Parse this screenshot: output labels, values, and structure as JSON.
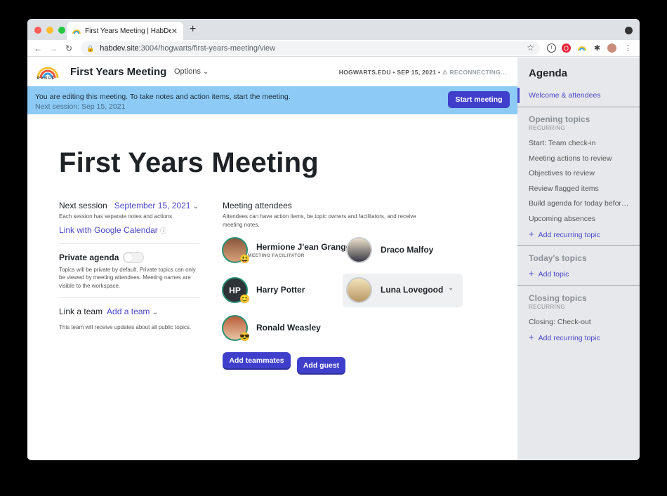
{
  "browser": {
    "tab_title": "First Years Meeting | HabDev",
    "url_host": "habdev.site",
    "url_path": ":3004/hogwarts/first-years-meeting/view"
  },
  "header": {
    "logo_text": "RANGE",
    "title": "First Years Meeting",
    "options_label": "Options",
    "meta_org_date": "HOGWARTS.EDU • SEP 15, 2021 •",
    "meta_status": "RECONNECTING..."
  },
  "banner": {
    "message": "You are editing this meeting. To take notes and action items, start the meeting.",
    "next_session": "Next session: Sep 15, 2021",
    "start_button": "Start meeting"
  },
  "page_title": "First Years Meeting",
  "left": {
    "next_session_label": "Next session",
    "next_session_value": "September 15, 2021",
    "next_session_note": "Each session has separate notes and actions.",
    "calendar_link": "Link with Google Calendar",
    "private_label": "Private agenda",
    "private_note": "Topics will be private by default. Private topics can only be viewed by meeting attendees. Meeting names are visible to the workspace.",
    "team_label": "Link a team",
    "team_value": "Add a team",
    "team_note": "This team will receive updates about all public topics."
  },
  "attendees": {
    "heading": "Meeting attendees",
    "subtitle": "Attendees can have action items, be topic owners and facilitators, and receive meeting notes.",
    "people": [
      {
        "name": "Hermione J'ean Granger",
        "role": "MEETING FACILITATOR",
        "emoji": "😃"
      },
      {
        "name": "Draco Malfoy"
      },
      {
        "name": "Harry Potter",
        "initials": "HP",
        "emoji": "😊"
      },
      {
        "name": "Luna Lovegood"
      },
      {
        "name": "Ronald Weasley",
        "emoji": "😎"
      }
    ],
    "add_teammates": "Add teammates",
    "add_guest": "Add guest"
  },
  "sidebar": {
    "title": "Agenda",
    "welcome": "Welcome & attendees",
    "opening": {
      "heading": "Opening topics",
      "caption": "RECURRING",
      "items": [
        "Start: Team check-in",
        "Meeting actions to review",
        "Objectives to review",
        "Review flagged items",
        "Build agenda for today befor…",
        "Upcoming absences"
      ],
      "add": "Add recurring topic"
    },
    "today": {
      "heading": "Today's topics",
      "add": "Add topic"
    },
    "closing": {
      "heading": "Closing topics",
      "caption": "RECURRING",
      "items": [
        "Closing: Check-out"
      ],
      "add": "Add recurring topic"
    }
  },
  "colors": {
    "accent": "#3f3fcc",
    "banner": "#8dcbf6",
    "sidebar": "#e6e8eb"
  }
}
